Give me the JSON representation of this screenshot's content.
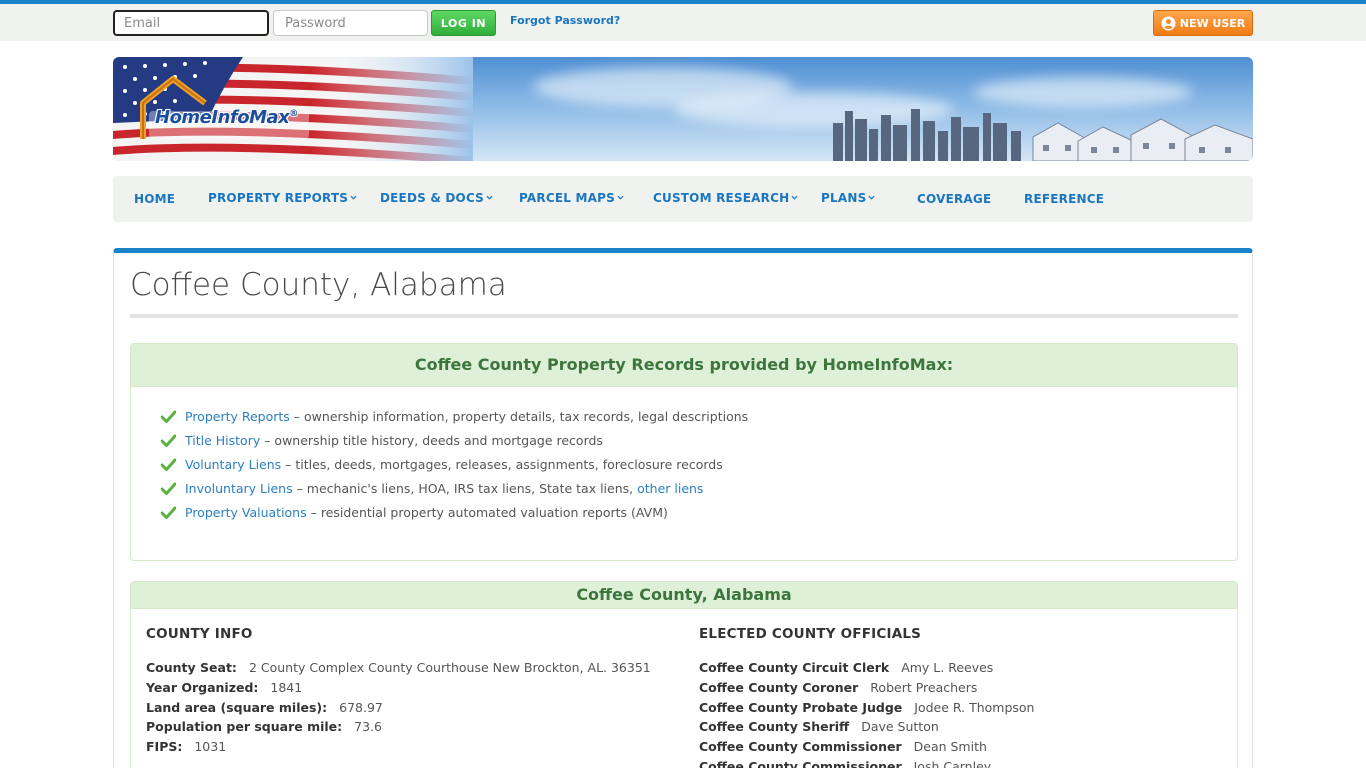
{
  "login": {
    "email_placeholder": "Email",
    "password_placeholder": "Password",
    "login_label": "LOG IN",
    "forgot_label": "Forgot Password?",
    "new_user_label": "NEW USER"
  },
  "brand": {
    "logo_text": "HomeInfoMax",
    "registered": "®"
  },
  "nav": {
    "items": [
      {
        "label": "HOME",
        "dropdown": false
      },
      {
        "label": "PROPERTY REPORTS",
        "dropdown": true
      },
      {
        "label": "DEEDS & DOCS",
        "dropdown": true
      },
      {
        "label": "PARCEL MAPS",
        "dropdown": true
      },
      {
        "label": "CUSTOM RESEARCH",
        "dropdown": true
      },
      {
        "label": "PLANS",
        "dropdown": true
      },
      {
        "label": "COVERAGE",
        "dropdown": false
      },
      {
        "label": "REFERENCE",
        "dropdown": false
      }
    ]
  },
  "page": {
    "title": "Coffee County, Alabama"
  },
  "records_panel": {
    "heading": "Coffee County Property Records provided by HomeInfoMax:",
    "items": [
      {
        "link": "Property Reports",
        "desc": " – ownership information, property details, tax records, legal descriptions",
        "extra_link": ""
      },
      {
        "link": "Title History",
        "desc": " – ownership title history, deeds and mortgage records",
        "extra_link": ""
      },
      {
        "link": "Voluntary Liens",
        "desc": " – titles, deeds, mortgages, releases, assignments, foreclosure records",
        "extra_link": ""
      },
      {
        "link": "Involuntary Liens",
        "desc": " – mechanic's liens, HOA, IRS tax liens, State tax liens, ",
        "extra_link": "other liens"
      },
      {
        "link": "Property Valuations",
        "desc": " – residential property automated valuation reports (AVM)",
        "extra_link": ""
      }
    ]
  },
  "county_panel": {
    "heading": "Coffee County, Alabama",
    "info_title": "COUNTY INFO",
    "info": [
      {
        "key": "County Seat:",
        "value": "2 County Complex County Courthouse New Brockton, AL. 36351"
      },
      {
        "key": "Year Organized:",
        "value": "1841"
      },
      {
        "key": "Land area (square miles):",
        "value": "678.97"
      },
      {
        "key": "Population per square mile:",
        "value": "73.6"
      },
      {
        "key": "FIPS:",
        "value": "1031"
      }
    ],
    "officials_title": "ELECTED COUNTY OFFICIALS",
    "officials": [
      {
        "key": "Coffee County Circuit Clerk",
        "value": "Amy L. Reeves"
      },
      {
        "key": "Coffee County Coroner",
        "value": "Robert Preachers"
      },
      {
        "key": "Coffee County Probate Judge",
        "value": "Jodee R. Thompson"
      },
      {
        "key": "Coffee County Sheriff",
        "value": "Dave Sutton"
      },
      {
        "key": "Coffee County Commissioner",
        "value": "Dean Smith"
      },
      {
        "key": "Coffee County Commissioner",
        "value": "Josh Carnley"
      }
    ]
  },
  "colors": {
    "accent_blue": "#1a82c9",
    "link_blue": "#1a76c0",
    "login_green": "#2fae39",
    "new_user_orange": "#f07c14",
    "panel_green_bg": "#dff0d8",
    "panel_green_text": "#3c763d"
  },
  "icons": {
    "check": "check-icon",
    "user": "user-icon",
    "chevron": "chevron-down-icon"
  }
}
